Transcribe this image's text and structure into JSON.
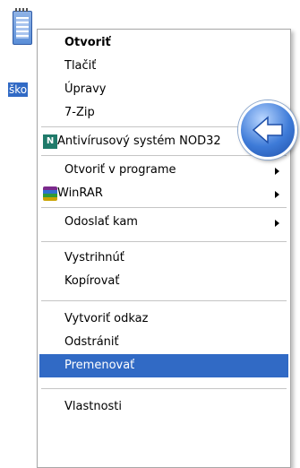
{
  "desktop": {
    "icon_name": "notepad-file-icon",
    "label": "ško"
  },
  "context_menu": {
    "items": [
      {
        "label": "Otvoriť"
      },
      {
        "label": "Tlačiť"
      },
      {
        "label": "Úpravy"
      },
      {
        "label": "7-Zip"
      },
      {
        "label": "Antivírusový systém NOD32"
      },
      {
        "label": "Otvoriť v programe"
      },
      {
        "label": "WinRAR"
      },
      {
        "label": "Odoslať kam"
      },
      {
        "label": "Vystrihnúť"
      },
      {
        "label": "Kopírovať"
      },
      {
        "label": "Vytvoriť odkaz"
      },
      {
        "label": "Odstrániť"
      },
      {
        "label": "Premenovať"
      },
      {
        "label": "Vlastnosti"
      }
    ],
    "highlighted_item": "Premenovať",
    "nod32_icon_letter": "N"
  },
  "overlay": {
    "icon": "back-arrow-icon"
  },
  "colors": {
    "highlight": "#316ac5",
    "menu_background": "#ffffff"
  }
}
